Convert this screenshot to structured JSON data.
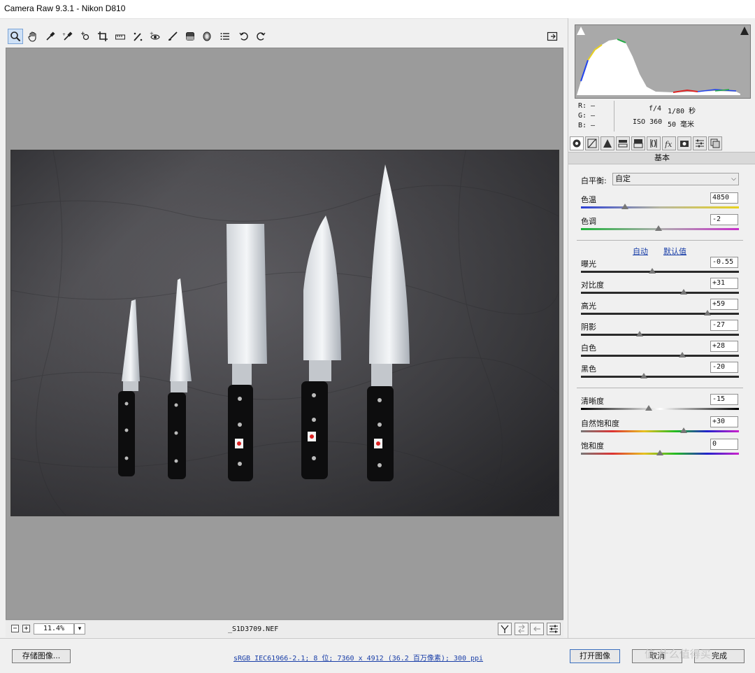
{
  "window": {
    "title": "Camera Raw 9.3.1 -  Nikon D810"
  },
  "toolbar": {
    "tools": [
      "zoom-tool",
      "hand-tool",
      "white-balance-tool",
      "color-sampler-tool",
      "targeted-adjustment-tool",
      "crop-tool",
      "straighten-tool",
      "spot-removal-tool",
      "red-eye-removal-tool",
      "adjustment-brush",
      "graduated-filter",
      "radial-filter",
      "preferences",
      "rotate-left",
      "rotate-right"
    ],
    "active_tool": "zoom-tool",
    "fullscreen_icon": "fullscreen-toggle-icon"
  },
  "status": {
    "zoom": "11.4%",
    "filename": "_S1D3709.NEF"
  },
  "info": {
    "r_label": "R:",
    "g_label": "G:",
    "b_label": "B:",
    "r_value": "—",
    "g_value": "—",
    "b_value": "—",
    "aperture": "f/4",
    "shutter": "1/80 秒",
    "iso": "ISO 360",
    "focal": "50 毫米"
  },
  "panel": {
    "section_title": "基本",
    "wb_label": "白平衡:",
    "wb_value": "自定",
    "auto_link": "自动",
    "default_link": "默认值"
  },
  "sliders": [
    {
      "id": "temp",
      "label": "色温",
      "value": "4850",
      "level": 0.28
    },
    {
      "id": "tint",
      "label": "色调",
      "value": "-2",
      "level": 0.49
    },
    {
      "id": "exposure",
      "label": "曝光",
      "value": "-0.55",
      "level": 0.45
    },
    {
      "id": "contrast",
      "label": "对比度",
      "value": "+31",
      "level": 0.65
    },
    {
      "id": "highlights",
      "label": "高光",
      "value": "+59",
      "level": 0.8
    },
    {
      "id": "shadows",
      "label": "阴影",
      "value": "-27",
      "level": 0.37
    },
    {
      "id": "whites",
      "label": "白色",
      "value": "+28",
      "level": 0.64
    },
    {
      "id": "blacks",
      "label": "黑色",
      "value": "-20",
      "level": 0.4
    },
    {
      "id": "clarity",
      "label": "清晰度",
      "value": "-15",
      "level": 0.43
    },
    {
      "id": "vibrance",
      "label": "自然饱和度",
      "value": "+30",
      "level": 0.65
    },
    {
      "id": "saturation",
      "label": "饱和度",
      "value": "0",
      "level": 0.5
    }
  ],
  "bottom": {
    "save_label": "存储图像...",
    "workflow_link": "sRGB IEC61966-2.1; 8 位; 7360 x 4912 (36.2 百万像素); 300 ppi",
    "open_label": "打开图像",
    "cancel_label": "取消",
    "done_label": "完成",
    "watermark": "值 什么值得买"
  }
}
